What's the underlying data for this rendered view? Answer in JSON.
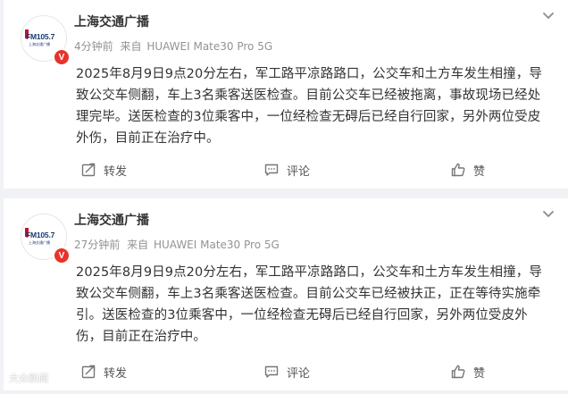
{
  "posts": [
    {
      "author": "上海交通广播",
      "avatar_text": "FM105.7",
      "avatar_subtext": "上海交通广播",
      "verified_badge": "V",
      "time": "4分钟前",
      "source_prefix": "来自",
      "device": "HUAWEI Mate30 Pro 5G",
      "text": "2025年8月9日9点20分左右，军工路平凉路路口，公交车和土方车发生相撞，导致公交车侧翻，车上3名乘客送医检查。目前公交车已经被拖离，事故现场已经处理完毕。送医检查的3位乘客中，一位经检查无碍后已经自行回家，另外两位受皮外伤，目前正在治疗中。",
      "repost_label": "转发",
      "comment_label": "评论",
      "like_label": "赞"
    },
    {
      "author": "上海交通广播",
      "avatar_text": "FM105.7",
      "avatar_subtext": "上海交通广播",
      "verified_badge": "V",
      "time": "27分钟前",
      "source_prefix": "来自",
      "device": "HUAWEI Mate30 Pro 5G",
      "text": "2025年8月9日9点20分左右，军工路平凉路路口，公交车和土方车发生相撞，导致公交车侧翻，车上3名乘客送医检查。目前公交车已经被扶正，正在等待实施牵引。送医检查的3位乘客中，一位经检查无碍后已经自行回家，另外两位受皮外伤，目前正在治疗中。",
      "repost_label": "转发",
      "comment_label": "评论",
      "like_label": "赞"
    }
  ],
  "watermark": "大众新闻",
  "colors": {
    "page_bg": "#f1f2f5",
    "card_bg": "#ffffff",
    "meta_gray": "#939393",
    "verified_red": "#e8332a",
    "logo_blue": "#1a3a72"
  },
  "icons": [
    "chevron-down-icon",
    "repost-icon",
    "comment-icon",
    "like-icon",
    "verified-icon"
  ]
}
